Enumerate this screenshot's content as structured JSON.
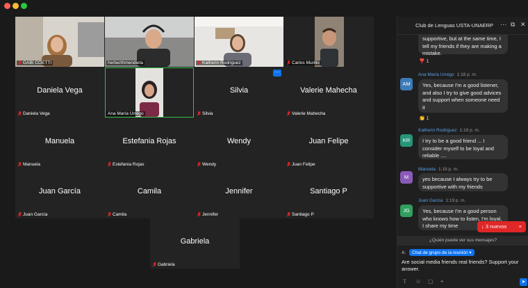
{
  "window": {
    "controls": [
      "close",
      "minimize",
      "zoom"
    ]
  },
  "gallery": {
    "tiles": [
      {
        "name": "GABI COETTI",
        "video": true,
        "muted": true
      },
      {
        "name": "herberthmendieta",
        "video": true,
        "muted": false
      },
      {
        "name": "Katherin Rodriguez",
        "video": true,
        "muted": true
      },
      {
        "name": "Carlos Murillo",
        "video": true,
        "muted": true
      },
      {
        "name": "Daniela Vega",
        "display": "Daniela Vega",
        "video": false,
        "muted": true
      },
      {
        "name": "Ana María Urrego",
        "video": true,
        "muted": false,
        "active": true
      },
      {
        "name": "Silvia",
        "display": "Silvia",
        "video": false,
        "muted": true
      },
      {
        "name": "Valerie Mahecha",
        "display": "Valerie Mahecha",
        "video": false,
        "muted": true
      },
      {
        "name": "Manuela",
        "display": "Manuela",
        "video": false,
        "muted": true
      },
      {
        "name": "Estefania Rojas",
        "display": "Estefania Rojas",
        "video": false,
        "muted": true
      },
      {
        "name": "Wendy",
        "display": "Wendy",
        "video": false,
        "muted": true
      },
      {
        "name": "Juan Felipe",
        "display": "Juan Felipe",
        "video": false,
        "muted": true
      },
      {
        "name": "Juan García",
        "display": "Juan García",
        "video": false,
        "muted": true
      },
      {
        "name": "Camila",
        "display": "Camila",
        "video": false,
        "muted": true
      },
      {
        "name": "Jennifer",
        "display": "Jennifer",
        "video": false,
        "muted": true
      },
      {
        "name": "Santiago P",
        "display": "Santiago P",
        "video": false,
        "muted": true
      }
    ],
    "extra_tile": {
      "name": "Gabriela",
      "display": "Gabriela"
    },
    "more_label": "···"
  },
  "chat": {
    "title": "Club de Lenguas USTA-UNAERP",
    "head_icons": [
      "more-icon",
      "popout-icon",
      "close-icon"
    ],
    "first_bubble": "supportive, but at the same time, I tell my friends if they are making a mistake.",
    "first_reaction": "❣️ 1",
    "messages": [
      {
        "initials": "AM",
        "color": "#3d7ab8",
        "name": "Ana María Urrego",
        "time": "1:18 p. m.",
        "text": "Yes, because I'm a good listener, and also I try to give good advices and support when someone need it",
        "reaction": "👏 1"
      },
      {
        "initials": "KR",
        "color": "#27957a",
        "name": "Katherin Rodriguez",
        "time": "1:19 p. m.",
        "text": "I try to be a good friend ... I consider myself to be loyal and reliable ...."
      },
      {
        "initials": "M",
        "color": "#8a5ab8",
        "name": "Manuela",
        "time": "1:19 p. m.",
        "text": "yes because I always try to be supportive with my friends"
      },
      {
        "initials": "JG",
        "color": "#2f9e5f",
        "name": "Juan García",
        "time": "1:19 p. m.",
        "text": "Yes, because I'm a good person who knows how to listen, I'm loyal, I share my time"
      }
    ],
    "new_badge": "↓ 3 nuevos",
    "new_badge_close": "×",
    "who_can_see": "¿Quién puede ver sus mensajes?",
    "to_label": "A:",
    "to_value": "Chat de grupo de la reunión ▾",
    "compose_text": "Are social media friends real friends? Support your answer.",
    "tool_icons": [
      "format-icon",
      "emoji-icon",
      "file-icon",
      "screenshot-icon"
    ]
  },
  "colors": {
    "active_speaker": "#2fbf4a",
    "accent": "#0e72ed",
    "badge": "#e02727"
  }
}
